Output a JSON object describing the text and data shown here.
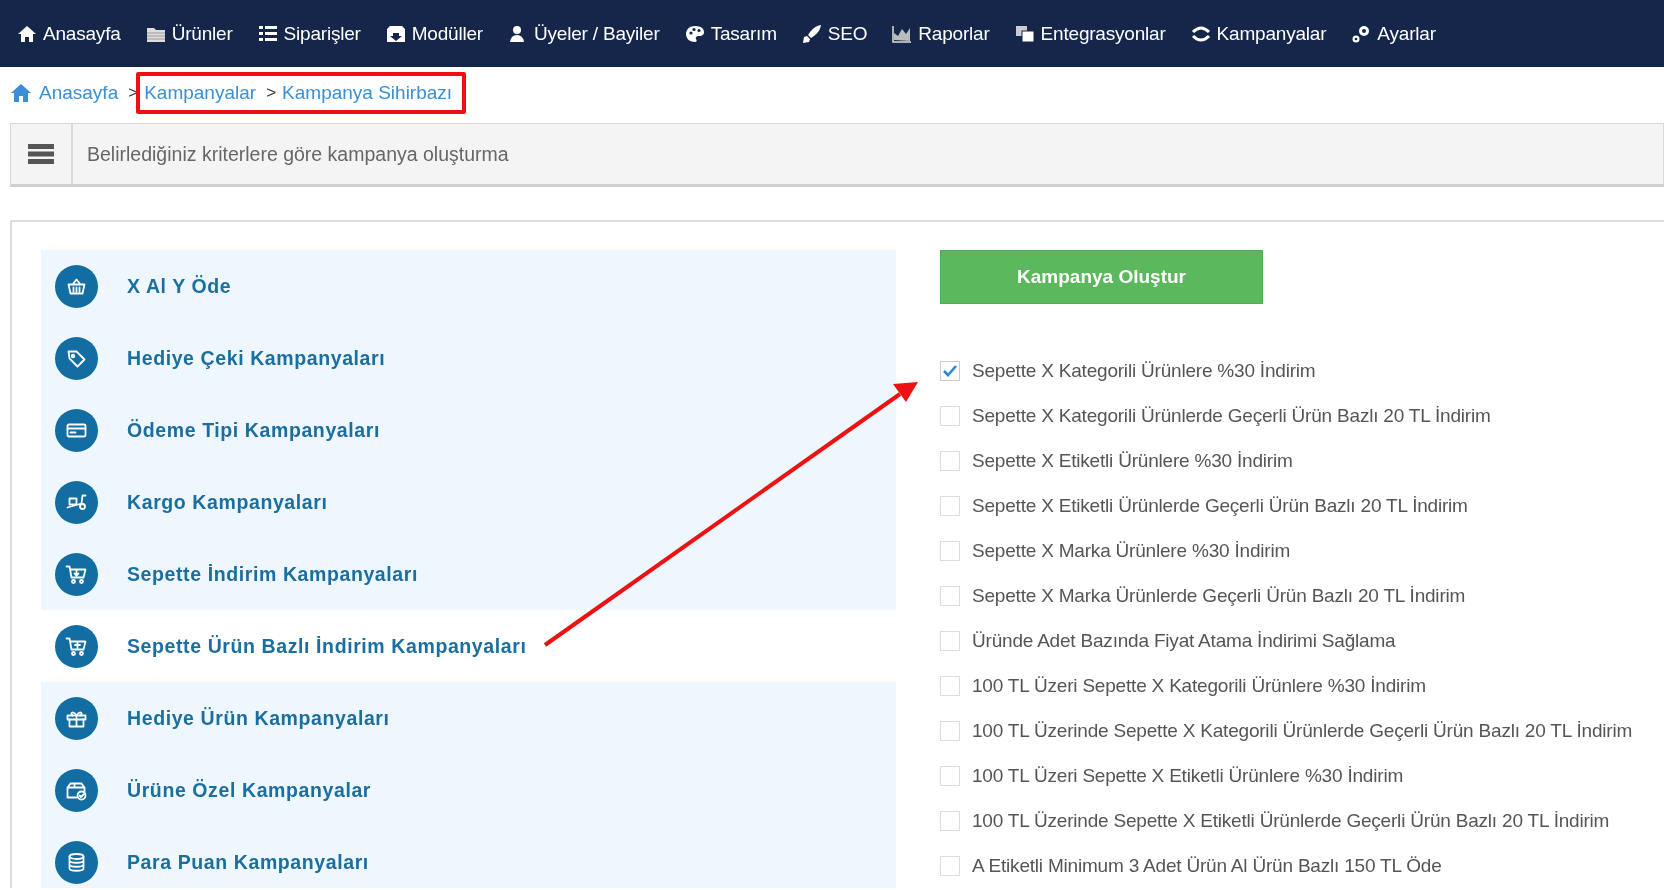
{
  "nav": [
    {
      "label": "Anasayfa"
    },
    {
      "label": "Ürünler"
    },
    {
      "label": "Siparişler"
    },
    {
      "label": "Modüller"
    },
    {
      "label": "Üyeler / Bayiler"
    },
    {
      "label": "Tasarım"
    },
    {
      "label": "SEO"
    },
    {
      "label": "Raporlar"
    },
    {
      "label": "Entegrasyonlar"
    },
    {
      "label": "Kampanyalar"
    },
    {
      "label": "Ayarlar"
    }
  ],
  "breadcrumb": {
    "home": "Anasayfa",
    "separators": [
      ">",
      ">"
    ],
    "items": [
      "Kampanyalar",
      "Kampanya Sihirbazı"
    ]
  },
  "header": {
    "title": "Belirlediğiniz kriterlere göre kampanya oluşturma"
  },
  "sidebar": {
    "items": [
      {
        "label": "X Al Y Öde",
        "selected": false
      },
      {
        "label": "Hediye Çeki Kampanyaları",
        "selected": false
      },
      {
        "label": "Ödeme Tipi Kampanyaları",
        "selected": false
      },
      {
        "label": "Kargo Kampanyaları",
        "selected": false
      },
      {
        "label": "Sepette İndirim Kampanyaları",
        "selected": false
      },
      {
        "label": "Sepette Ürün Bazlı İndirim Kampanyaları",
        "selected": true
      },
      {
        "label": "Hediye Ürün Kampanyaları",
        "selected": false
      },
      {
        "label": "Ürüne Özel Kampanyalar",
        "selected": false
      },
      {
        "label": "Para Puan Kampanyaları",
        "selected": false
      }
    ]
  },
  "create_button": "Kampanya Oluştur",
  "options": [
    {
      "label": "Sepette X Kategorili Ürünlere %30 İndirim",
      "checked": true
    },
    {
      "label": "Sepette X Kategorili Ürünlerde Geçerli Ürün Bazlı 20 TL İndirim",
      "checked": false
    },
    {
      "label": "Sepette X Etiketli Ürünlere %30 İndirim",
      "checked": false
    },
    {
      "label": "Sepette X Etiketli Ürünlerde Geçerli Ürün Bazlı 20 TL İndirim",
      "checked": false
    },
    {
      "label": "Sepette X Marka Ürünlere %30 İndirim",
      "checked": false
    },
    {
      "label": "Sepette X Marka Ürünlerde Geçerli Ürün Bazlı 20 TL İndirim",
      "checked": false
    },
    {
      "label": "Üründe Adet Bazında Fiyat Atama İndirimi Sağlama",
      "checked": false
    },
    {
      "label": "100 TL Üzeri Sepette X Kategorili Ürünlere %30 İndirim",
      "checked": false
    },
    {
      "label": "100 TL Üzerinde Sepette X Kategorili Ürünlerde Geçerli Ürün Bazlı 20 TL İndirim",
      "checked": false
    },
    {
      "label": "100 TL Üzeri Sepette X Etiketli Ürünlere %30 İndirim",
      "checked": false
    },
    {
      "label": "100 TL Üzerinde Sepette X Etiketli Ürünlerde Geçerli Ürün Bazlı 20 TL İndirim",
      "checked": false
    },
    {
      "label": "A Etiketli Minimum 3 Adet Ürün Al Ürün Bazlı 150 TL Öde",
      "checked": false
    }
  ]
}
